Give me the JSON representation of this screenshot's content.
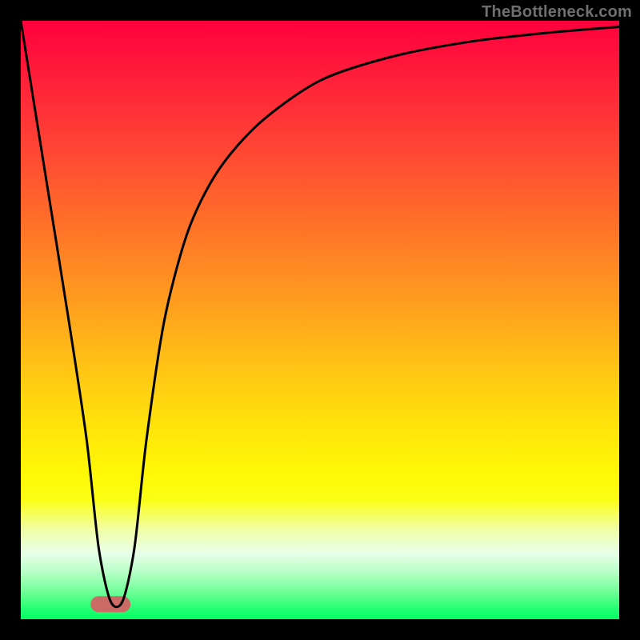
{
  "watermark": "TheBottleneck.com",
  "chart_data": {
    "type": "line",
    "title": "",
    "xlabel": "",
    "ylabel": "",
    "xlim": [
      0,
      100
    ],
    "ylim": [
      0,
      100
    ],
    "grid": false,
    "legend": false,
    "background": {
      "type": "vertical-gradient",
      "stops": [
        {
          "pos": 0,
          "color": "#ff003d"
        },
        {
          "pos": 50,
          "color": "#ffb018"
        },
        {
          "pos": 78,
          "color": "#feff08"
        },
        {
          "pos": 100,
          "color": "#00ff66"
        }
      ]
    },
    "series": [
      {
        "name": "bottleneck-curve",
        "color": "#000000",
        "x": [
          0,
          4,
          8,
          11,
          13,
          15,
          17,
          19,
          21,
          24,
          28,
          33,
          40,
          50,
          62,
          75,
          88,
          100
        ],
        "y": [
          100,
          75,
          50,
          30,
          12,
          3,
          3,
          12,
          30,
          50,
          65,
          75,
          83,
          90,
          94,
          96.5,
          98,
          99
        ]
      }
    ],
    "markers": [
      {
        "name": "trough-marker",
        "shape": "rounded-capsule",
        "color": "#cb6b65",
        "x_range": [
          13,
          17
        ],
        "y": 2.5
      }
    ]
  }
}
